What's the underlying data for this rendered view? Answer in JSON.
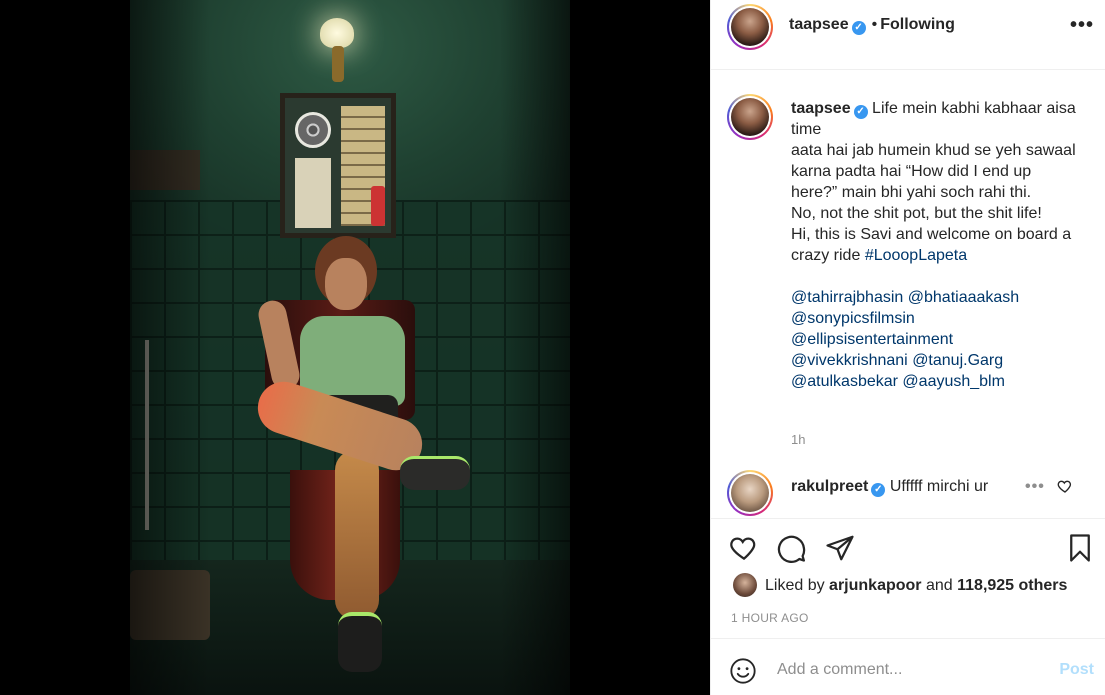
{
  "post": {
    "username": "taapsee",
    "follow_separator": "•",
    "follow_status": "Following",
    "more_icon": "more-horizontal-icon"
  },
  "caption": {
    "username": "taapsee",
    "lines": [
      "Life mein kabhi kabhaar aisa time",
      "aata hai jab humein khud se yeh sawaal karna padta hai “How did I end up here?” main bhi yahi soch rahi thi.",
      "No, not the shit pot, but the shit life!",
      "Hi, this is Savi and welcome on board a crazy ride"
    ],
    "hashtag": "#LooopLapeta",
    "mentions_line1": [
      "@tahirrajbhasin",
      "@bhatiaaakash"
    ],
    "mentions_line2": [
      "@sonypicsfilmsin"
    ],
    "mentions_line3": [
      "@ellipsisentertainment"
    ],
    "mentions_line4": [
      "@vivekkrishnani",
      "@tanuj.Garg"
    ],
    "mentions_line5": [
      "@atulkasbekar",
      "@aayush_blm"
    ],
    "time": "1h"
  },
  "comment": {
    "username": "rakulpreet",
    "text": "Ufffff mirchi ur",
    "more_label": "•••"
  },
  "actions": {
    "liked_prefix": "Liked by",
    "liked_user": "arjunkapoor",
    "liked_and": "and",
    "likes_count": "118,925 others",
    "timestamp": "1 HOUR AGO"
  },
  "add_comment": {
    "placeholder": "Add a comment...",
    "post_label": "Post"
  },
  "colors": {
    "verified": "#3897f0",
    "link": "#00376b",
    "muted": "#8e8e8e",
    "post_disabled": "#b2dffc"
  }
}
